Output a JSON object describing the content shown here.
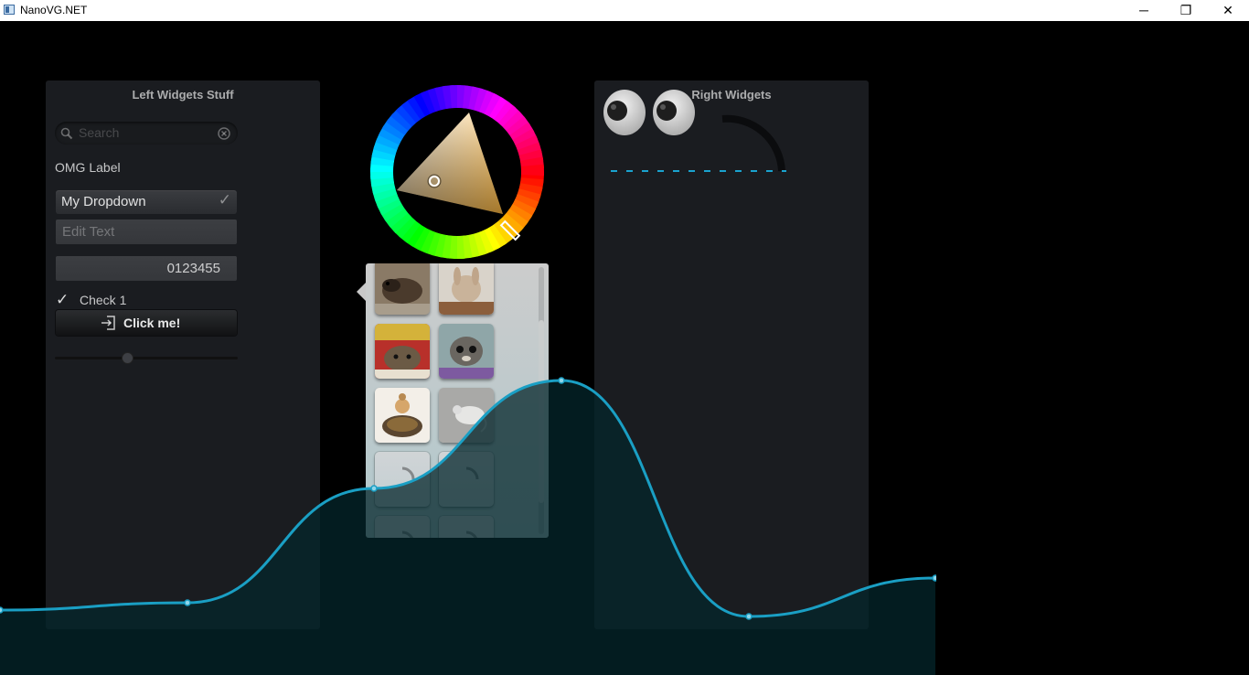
{
  "window": {
    "title": "NanoVG.NET",
    "minimize": "─",
    "maximize": "❐",
    "close": "✕"
  },
  "left_panel": {
    "title": "Left Widgets Stuff",
    "search_placeholder": "Search",
    "label": "OMG Label",
    "dropdown": "My Dropdown",
    "edit_text_placeholder": "Edit Text",
    "number_value": "0123455",
    "checkbox": {
      "label": "Check 1",
      "checked": true
    },
    "button": "Click me!",
    "slider": {
      "value": 0.4
    }
  },
  "right_panel": {
    "title": "Right Widgets"
  },
  "color_wheel": {
    "hue_deg": 30
  },
  "thumbnails": {
    "items": [
      {
        "name": "thumb-animal-rodent"
      },
      {
        "name": "thumb-rabbit"
      },
      {
        "name": "thumb-cat"
      },
      {
        "name": "thumb-lemur"
      },
      {
        "name": "thumb-tortoise"
      },
      {
        "name": "thumb-mouse"
      },
      {
        "name": "thumb-loading"
      },
      {
        "name": "thumb-loading"
      },
      {
        "name": "thumb-loading"
      },
      {
        "name": "thumb-loading"
      }
    ]
  },
  "graph": {
    "line_color": "#1a9fc4",
    "fill_color": "#04262b"
  }
}
